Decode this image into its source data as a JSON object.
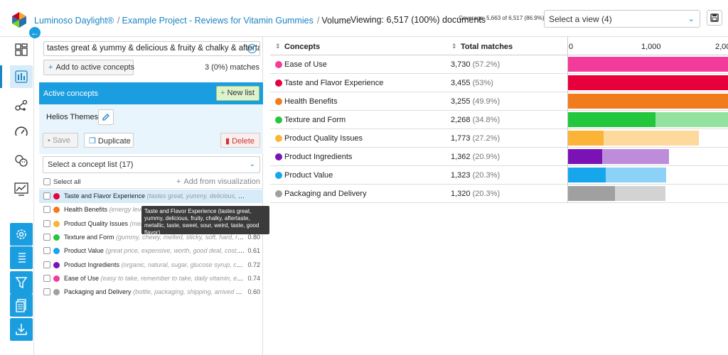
{
  "header": {
    "app_name": "Luminoso Daylight®",
    "project": "Example Project - Reviews for Vitamin Gummies",
    "page": "Volume",
    "viewing": "Viewing: 6,517 (100%) documents",
    "coverage": "Coverage: 5,663 of 6,517 (86.9%)",
    "view_select": "Select a view (4)"
  },
  "nav": {
    "icons": [
      "dashboard-icon",
      "volume-chart-icon",
      "galaxy-icon",
      "gauge-icon",
      "sentiment-icon",
      "trend-chart-icon"
    ],
    "tools": [
      "settings-icon",
      "list-icon",
      "filter-icon",
      "documents-icon",
      "download-icon"
    ]
  },
  "panel": {
    "search_value": "tastes great & yummy & delicious & fruity & chalky & aftertaste",
    "add_to_active": "Add to active concepts",
    "match_count": "3 (0%) matches",
    "active_title": "Active concepts",
    "new_list": "New list",
    "list_name": "Helios Themes",
    "save": "Save",
    "duplicate": "Duplicate",
    "delete": "Delete",
    "concept_list_select": "Select a concept list (17)",
    "select_all": "Select all",
    "add_from_vis": "Add from visualization",
    "concepts": [
      {
        "name": "Taste and Flavor Experience",
        "terms": "(tastes great, yummy, delicious, fruity, ch...",
        "score": "",
        "color": "#e8003d"
      },
      {
        "name": "Health Benefits",
        "terms": "(energy leve...",
        "score": "",
        "color": "#f07c1b"
      },
      {
        "name": "Product Quality Issues",
        "terms": "(melt...",
        "score": "",
        "color": "#fbb437"
      },
      {
        "name": "Texture and Form",
        "terms": "(gummy, chewy, melted, sticky, soft, hard, rubb...",
        "score": "0.80",
        "color": "#22c73d"
      },
      {
        "name": "Product Value",
        "terms": "(great price, expensive, worth, good deal, cost, valu...",
        "score": "0.61",
        "color": "#16a6ec"
      },
      {
        "name": "Product Ingredients",
        "terms": "(organic, natural, sugar, glucose syrup, calciu...",
        "score": "0.72",
        "color": "#7b12b6"
      },
      {
        "name": "Ease of Use",
        "terms": "(easy to take, remember to take, daily vitamin, empty ...",
        "score": "0.74",
        "color": "#f23b9b"
      },
      {
        "name": "Packaging and Delivery",
        "terms": "(bottle, packaging, shipping, arrived melte...",
        "score": "0.60",
        "color": "#a0a0a0"
      }
    ],
    "tooltip": "Taste and Flavor Experience (tastes great, yummy, delicious, fruity, chalky, aftertaste, metallic, taste, sweet, sour, weird, taste, good flavor)"
  },
  "table": {
    "col_concepts": "Concepts",
    "col_total": "Total matches",
    "ticks": [
      "0",
      "1,000",
      "2,00"
    ],
    "rows": [
      {
        "name": "Ease of Use",
        "count": "3,730",
        "pct": "(57.2%)",
        "color": "#f23b9b",
        "light": "#f9a2cf",
        "value": 3730,
        "exact": 3730
      },
      {
        "name": "Taste and Flavor Experience",
        "count": "3,455",
        "pct": "(53%)",
        "color": "#e8003d",
        "light": "#f38fa6",
        "value": 3455,
        "exact": 3455
      },
      {
        "name": "Health Benefits",
        "count": "3,255",
        "pct": "(49.9%)",
        "color": "#f07c1b",
        "light": "#f8c08f",
        "value": 3255,
        "exact": 3255
      },
      {
        "name": "Texture and Form",
        "count": "2,268",
        "pct": "(34.8%)",
        "color": "#22c73d",
        "light": "#92e39e",
        "value": 2268,
        "exact": 1185
      },
      {
        "name": "Product Quality Issues",
        "count": "1,773",
        "pct": "(27.2%)",
        "color": "#fbb437",
        "light": "#fdd99b",
        "value": 1773,
        "exact": 480
      },
      {
        "name": "Product Ingredients",
        "count": "1,362",
        "pct": "(20.9%)",
        "color": "#7b12b6",
        "light": "#bd8ddb",
        "value": 1362,
        "exact": 460
      },
      {
        "name": "Product Value",
        "count": "1,323",
        "pct": "(20.3%)",
        "color": "#16a6ec",
        "light": "#8bd2f6",
        "value": 1323,
        "exact": 505
      },
      {
        "name": "Packaging and Delivery",
        "count": "1,320",
        "pct": "(20.3%)",
        "color": "#a0a0a0",
        "light": "#d3d3d3",
        "value": 1320,
        "exact": 630
      }
    ]
  }
}
